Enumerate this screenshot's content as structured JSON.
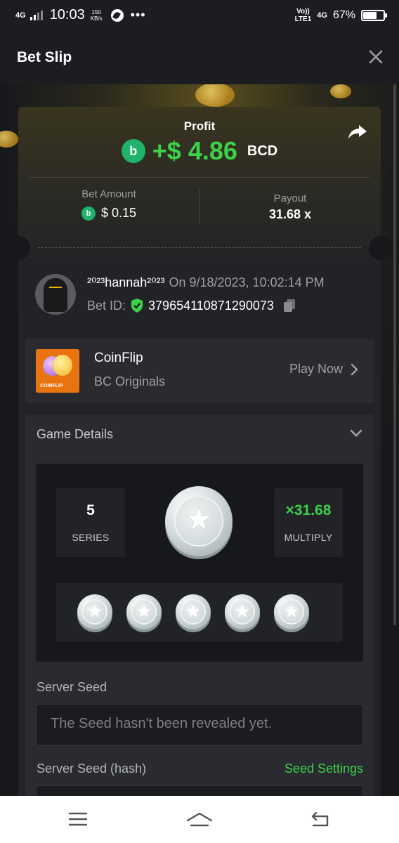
{
  "status_bar": {
    "network_left": "4G",
    "time": "10:03",
    "speed_value": "150",
    "speed_unit": "KB/s",
    "dots": "•••",
    "volte_top": "Vo))",
    "volte_bottom": "LTE1",
    "network_right": "4G",
    "battery_percent": "67%",
    "battery_level": 0.67
  },
  "header": {
    "title": "Bet Slip"
  },
  "profit": {
    "label": "Profit",
    "value": "+$ 4.86",
    "currency": "BCD"
  },
  "bet_amount": {
    "label": "Bet Amount",
    "value": "$ 0.15"
  },
  "payout": {
    "label": "Payout",
    "value": "31.68 x"
  },
  "user": {
    "name": "²⁰²³hannah²⁰²³",
    "date": "On 9/18/2023, 10:02:14 PM",
    "bet_id_label": "Bet ID:",
    "bet_id": "379654110871290073"
  },
  "game": {
    "name": "CoinFlip",
    "provider": "BC Originals",
    "thumb_text": "COINFLIP",
    "play_label": "Play Now"
  },
  "details": {
    "title": "Game Details",
    "series_value": "5",
    "series_label": "SERIES",
    "multiply_value": "×31.68",
    "multiply_label": "MULTIPLY",
    "coin_count": 5,
    "server_seed_label": "Server Seed",
    "server_seed_placeholder": "The Seed hasn't been revealed yet.",
    "server_seed_hash_label": "Server Seed (hash)",
    "seed_settings_label": "Seed Settings"
  },
  "colors": {
    "accent_green": "#3bd24a",
    "bcd_green": "#1fb36b",
    "game_orange": "#e8730f"
  }
}
